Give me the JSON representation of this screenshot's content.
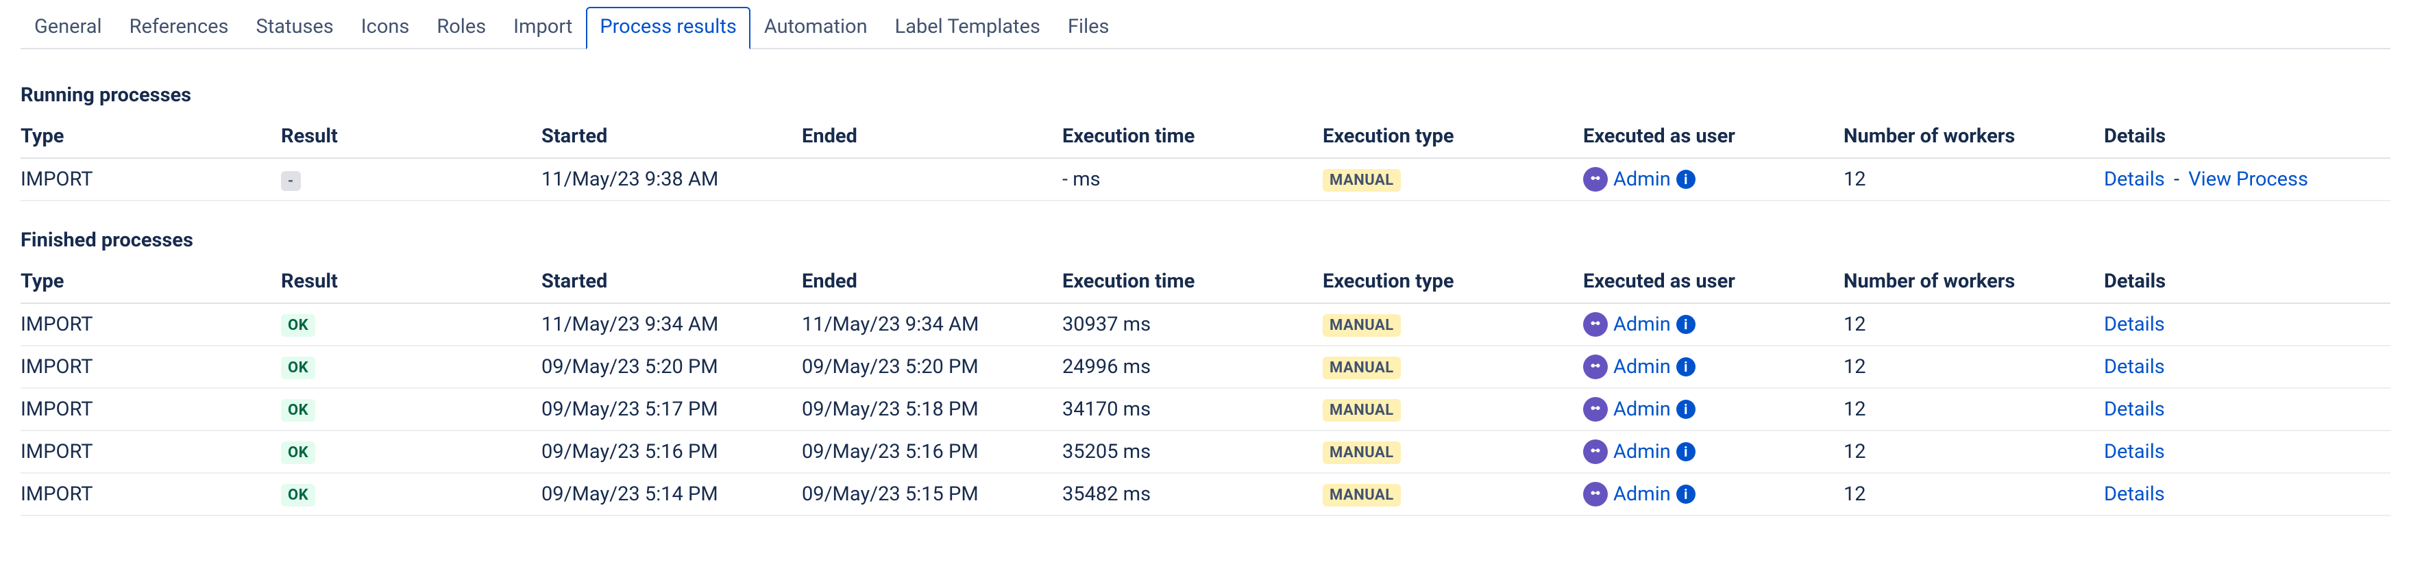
{
  "tabs": [
    {
      "label": "General"
    },
    {
      "label": "References"
    },
    {
      "label": "Statuses"
    },
    {
      "label": "Icons"
    },
    {
      "label": "Roles"
    },
    {
      "label": "Import"
    },
    {
      "label": "Process results",
      "active": true
    },
    {
      "label": "Automation"
    },
    {
      "label": "Label Templates"
    },
    {
      "label": "Files"
    }
  ],
  "columns": {
    "type": "Type",
    "result": "Result",
    "started": "Started",
    "ended": "Ended",
    "exec_time": "Execution time",
    "exec_type": "Execution type",
    "user": "Executed as user",
    "workers": "Number of workers",
    "details": "Details"
  },
  "running": {
    "title": "Running processes",
    "rows": [
      {
        "type": "IMPORT",
        "result": "-",
        "started": "11/May/23 9:38 AM",
        "ended": "",
        "exec_time": "- ms",
        "exec_type": "MANUAL",
        "user": "Admin",
        "workers": "12",
        "details_label": "Details",
        "view_label": "View Process"
      }
    ]
  },
  "finished": {
    "title": "Finished processes",
    "rows": [
      {
        "type": "IMPORT",
        "result": "OK",
        "started": "11/May/23 9:34 AM",
        "ended": "11/May/23 9:34 AM",
        "exec_time": "30937 ms",
        "exec_type": "MANUAL",
        "user": "Admin",
        "workers": "12",
        "details_label": "Details"
      },
      {
        "type": "IMPORT",
        "result": "OK",
        "started": "09/May/23 5:20 PM",
        "ended": "09/May/23 5:20 PM",
        "exec_time": "24996 ms",
        "exec_type": "MANUAL",
        "user": "Admin",
        "workers": "12",
        "details_label": "Details"
      },
      {
        "type": "IMPORT",
        "result": "OK",
        "started": "09/May/23 5:17 PM",
        "ended": "09/May/23 5:18 PM",
        "exec_time": "34170 ms",
        "exec_type": "MANUAL",
        "user": "Admin",
        "workers": "12",
        "details_label": "Details"
      },
      {
        "type": "IMPORT",
        "result": "OK",
        "started": "09/May/23 5:16 PM",
        "ended": "09/May/23 5:16 PM",
        "exec_time": "35205 ms",
        "exec_type": "MANUAL",
        "user": "Admin",
        "workers": "12",
        "details_label": "Details"
      },
      {
        "type": "IMPORT",
        "result": "OK",
        "started": "09/May/23 5:14 PM",
        "ended": "09/May/23 5:15 PM",
        "exec_time": "35482 ms",
        "exec_type": "MANUAL",
        "user": "Admin",
        "workers": "12",
        "details_label": "Details"
      }
    ]
  },
  "info_glyph": "i",
  "separator": "-"
}
